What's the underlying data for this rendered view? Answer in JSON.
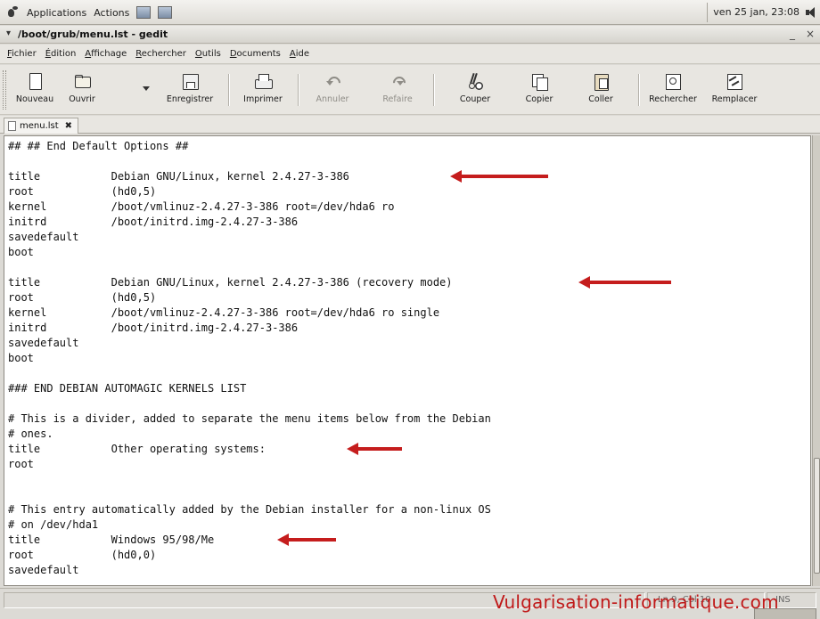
{
  "panel": {
    "applications": "Applications",
    "actions": "Actions",
    "clock": "ven 25 jan, 23:08"
  },
  "window": {
    "title": "/boot/grub/menu.lst - gedit",
    "minimize": "_",
    "close": "×"
  },
  "menubar": {
    "items": [
      {
        "mnemonic": "F",
        "rest": "ichier"
      },
      {
        "mnemonic": "É",
        "rest": "dition"
      },
      {
        "mnemonic": "A",
        "rest": "ffichage"
      },
      {
        "mnemonic": "R",
        "rest": "echercher"
      },
      {
        "mnemonic": "O",
        "rest": "utils"
      },
      {
        "mnemonic": "D",
        "rest": "ocuments"
      },
      {
        "mnemonic": "A",
        "rest": "ide"
      }
    ]
  },
  "toolbar": {
    "new": "Nouveau",
    "open": "Ouvrir",
    "save": "Enregistrer",
    "print": "Imprimer",
    "undo": "Annuler",
    "redo": "Refaire",
    "cut": "Couper",
    "copy": "Copier",
    "paste": "Coller",
    "find": "Rechercher",
    "replace": "Remplacer"
  },
  "tab": {
    "label": "menu.lst"
  },
  "editor": {
    "lines": [
      "## ## End Default Options ##",
      "",
      "title           Debian GNU/Linux, kernel 2.4.27-3-386",
      "root            (hd0,5)",
      "kernel          /boot/vmlinuz-2.4.27-3-386 root=/dev/hda6 ro",
      "initrd          /boot/initrd.img-2.4.27-3-386",
      "savedefault",
      "boot",
      "",
      "title           Debian GNU/Linux, kernel 2.4.27-3-386 (recovery mode)",
      "root            (hd0,5)",
      "kernel          /boot/vmlinuz-2.4.27-3-386 root=/dev/hda6 ro single",
      "initrd          /boot/initrd.img-2.4.27-3-386",
      "savedefault",
      "boot",
      "",
      "### END DEBIAN AUTOMAGIC KERNELS LIST",
      "",
      "# This is a divider, added to separate the menu items below from the Debian",
      "# ones.",
      "title           Other operating systems:",
      "root",
      "",
      "",
      "# This entry automatically added by the Debian installer for a non-linux OS",
      "# on /dev/hda1",
      "title           Windows 95/98/Me",
      "root            (hd0,0)",
      "savedefault"
    ]
  },
  "statusbar": {
    "position": "Ln 9, Col 10",
    "mode": "INS"
  },
  "watermark": "Vulgarisation-informatique.com",
  "colors": {
    "arrow": "#c51d1d",
    "watermark": "#c01919"
  }
}
